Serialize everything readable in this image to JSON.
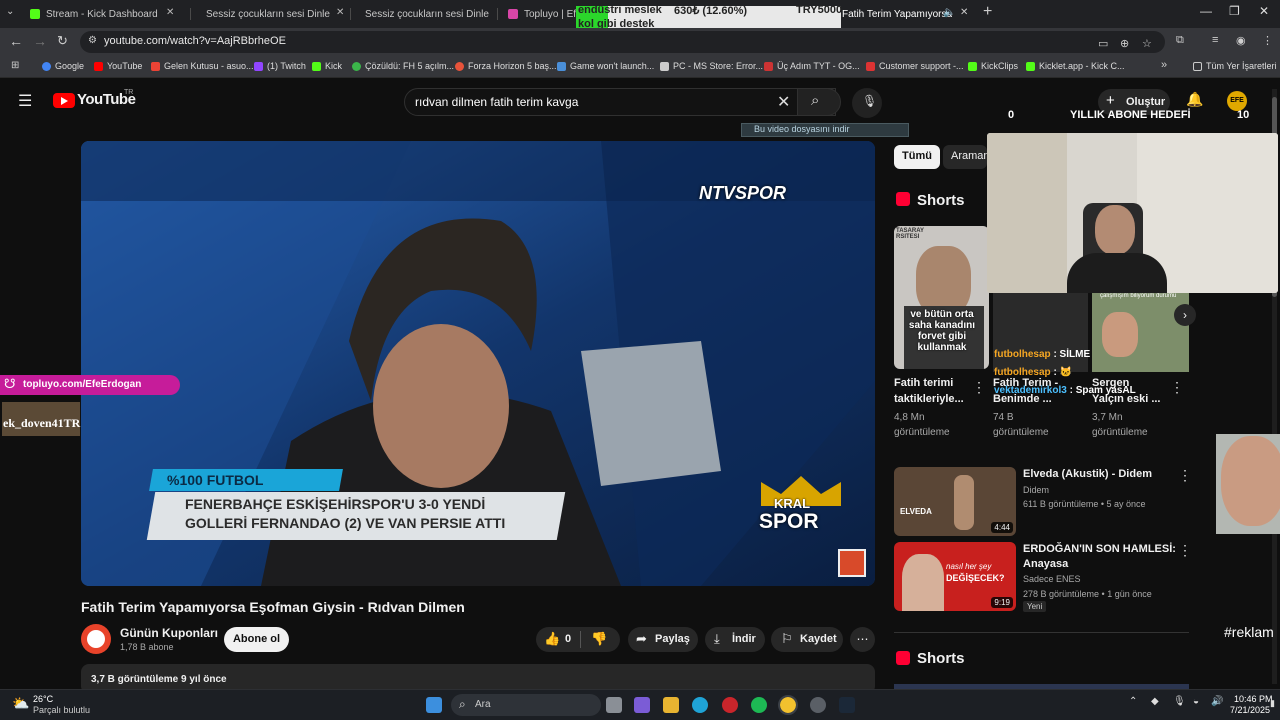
{
  "browser": {
    "tabs": [
      {
        "label": "Stream - Kick Dashboard",
        "color": "#53fc18"
      },
      {
        "label": "Sessiz çocukların sesi Dinle ve İ",
        "color": "#555"
      },
      {
        "label": "Sessiz çocukların sesi Dinle ve İ",
        "color": "#555"
      },
      {
        "label": "Topluyo | EfeE",
        "color": "#d946a8"
      },
      {
        "label": "Fatih Terim Yapamıyorsa Eş",
        "color": "#ff0000"
      }
    ],
    "url": "youtube.com/watch?v=AajRBbrheOE",
    "bookmarks": [
      "Google",
      "YouTube",
      "Gelen Kutusu - asuo...",
      "(1) Twitch",
      "Kick",
      "Çözüldü: FH 5 açılm...",
      "Forza Horizon 5 baş...",
      "Game won't launch...",
      "PC - MS Store: Error...",
      "Üç Adım TYT - OG...",
      "Customer support -...",
      "KickClips",
      "Kicklet.app - Kick C..."
    ],
    "all_bookmarks": "Tüm Yer İşaretleri"
  },
  "youtube": {
    "logo": "YouTube",
    "region": "TR",
    "search_value": "rıdvan dilmen fatih terim kavga",
    "create_label": "Oluştur",
    "video_title": "Fatih Terim Yapamıyorsa Eşofman Giysin - Rıdvan Dilmen",
    "channel_name": "Günün Kuponları",
    "subscribers": "1,78 B abone",
    "subscribe_label": "Abone ol",
    "likes": "0",
    "share_label": "Paylaş",
    "download_label": "İndir",
    "save_label": "Kaydet",
    "views_line": "3,7 B görüntüleme  9 yıl önce",
    "download_notice": "Bu video dosyasını indir",
    "chips": [
      "Tümü",
      "Araman"
    ],
    "shorts_header": "Shorts",
    "shorts": [
      {
        "title1": "Fatih terimi",
        "title2": "taktikleriyle...",
        "views1": "4,8 Mn",
        "views2": "görüntüleme",
        "caption": "ve bütün orta saha kanadını forvet gibi kullanmak",
        "tag": "TASARAY RSITESI"
      },
      {
        "title1": "Fatih Terim -",
        "title2": "Benimde ...",
        "views1": "74 B",
        "views2": "görüntüleme"
      },
      {
        "title1": "Sergen",
        "title2": "Yalçın eski ...",
        "views1": "3,7 Mn",
        "views2": "görüntüleme",
        "caption": "çalışmışım biliyorum durumu"
      }
    ],
    "videos": [
      {
        "title1": "Elveda (Akustik) - Didem",
        "title2": "",
        "channel": "Didem",
        "meta": "611 B görüntüleme • 5 ay önce",
        "duration": "4:44",
        "thumb_text": "ELVEDA"
      },
      {
        "title1": "ERDOĞAN'IN SON HAMLESİ:",
        "title2": "Anayasa",
        "channel": "Sadece ENES",
        "meta": "278 B görüntüleme • 1 gün önce",
        "duration": "9:19",
        "badge": "Yeni",
        "thumb_text1": "nasıl her şey",
        "thumb_text2": "DEĞİŞECEK?"
      }
    ],
    "shorts_header2": "Shorts"
  },
  "player": {
    "channel_logo": "NTVSPOR",
    "banner_top": "%100 FUTBOL",
    "banner_line1": "FENERBAHÇE ESKİŞEHİRSPOR'U 3-0 YENDİ",
    "banner_line2": "GOLLERİ FERNANDAO (2) VE VAN PERSIE ATTI",
    "corner_logo1": "KRAL",
    "corner_logo2": "SPOR"
  },
  "ticker": {
    "text1": "endüstri meslek",
    "text1b": "kol gibi destek",
    "amount": "630₺ (12.60%)",
    "goal": "TRY5000"
  },
  "overlay": {
    "goal_start": "0",
    "goal_title": "YILLIK ABONE HEDEFİ",
    "goal_end": "10",
    "topluyo": "topluyo.com/EfeErdogan",
    "kick_user": "ek_doven41TR",
    "chat": [
      {
        "user": "futbolhesap",
        "msg": " : SİLME"
      },
      {
        "user": "futbolhesap",
        "msg": " : 🐱"
      },
      {
        "user": "vektademirkol3",
        "msg": " : Spam yasAL"
      }
    ],
    "hashtag": "#reklam"
  },
  "taskbar": {
    "temp": "26°C",
    "weather": "Parçalı bulutlu",
    "search": "Ara",
    "time": "10:46 PM",
    "date": "7/21/2025"
  }
}
